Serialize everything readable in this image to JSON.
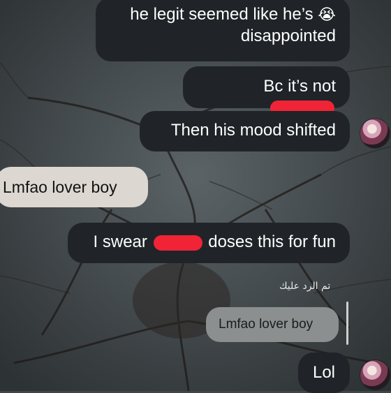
{
  "colors": {
    "outgoing_bubble": "#202428",
    "incoming_bubble": "#dcd8d1",
    "quoted_bubble": "#8b8f90",
    "redaction": "#f02436",
    "wallpaper": "#3f4649"
  },
  "messages": [
    {
      "direction": "outgoing",
      "text_line1": "he legit seemed like he’s",
      "emoji": "😭",
      "text_line2": "disappointed"
    },
    {
      "direction": "outgoing",
      "text_before": "Bc it’s not",
      "redacted": true
    },
    {
      "direction": "outgoing",
      "text": "Then his mood shifted",
      "avatar": true
    },
    {
      "direction": "incoming",
      "text": "Lmfao lover boy"
    },
    {
      "direction": "outgoing",
      "text_before": "I swear",
      "redacted": true,
      "text_after": "doses this for fun"
    },
    {
      "direction": "outgoing",
      "reply_label": "تم الرد عليك",
      "quoted_text": "Lmfao lover boy"
    },
    {
      "direction": "outgoing",
      "text": "Lol",
      "avatar": true
    }
  ]
}
